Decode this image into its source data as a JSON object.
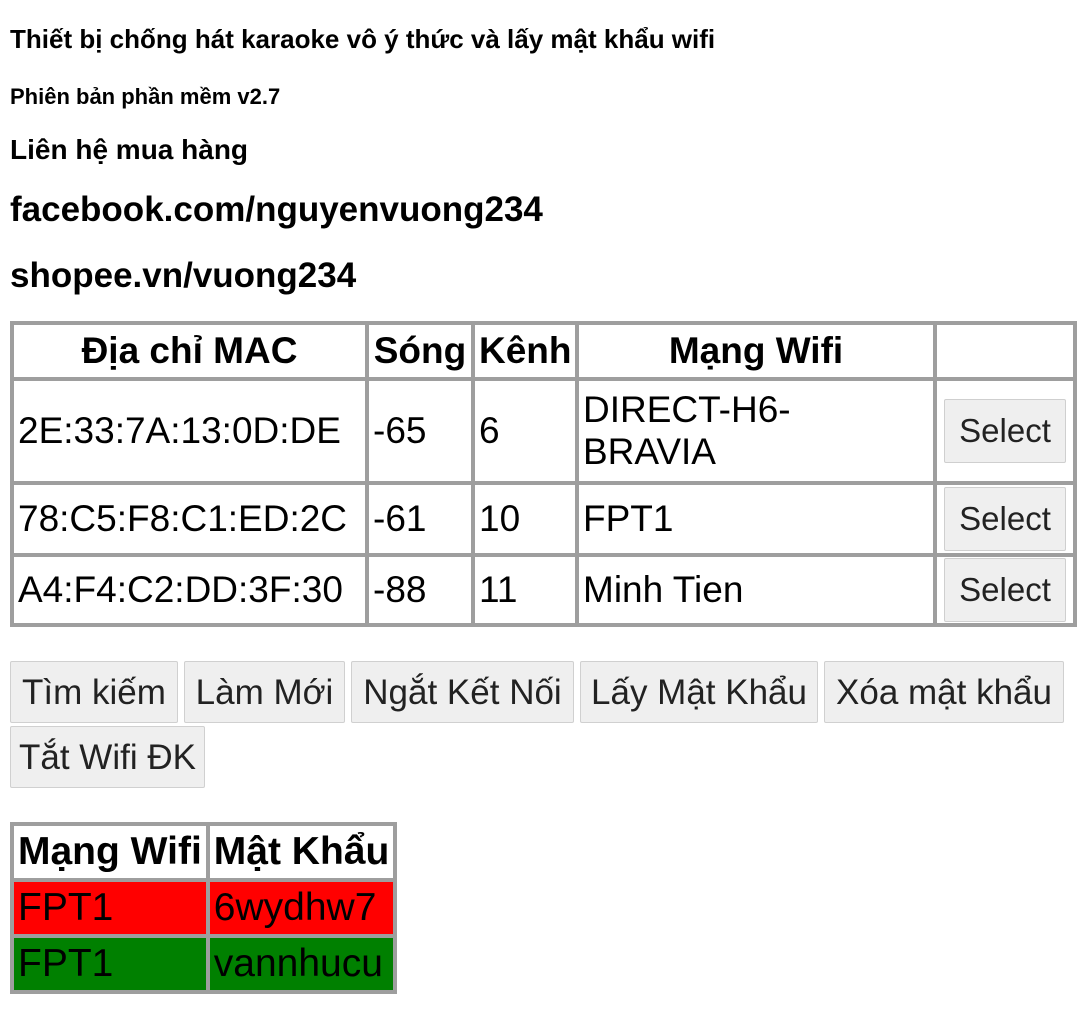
{
  "header": {
    "title": "Thiết bị chống hát karaoke vô ý thức và lấy mật khẩu wifi",
    "version": "Phiên bản phần mềm v2.7",
    "contact_label": "Liên hệ mua hàng",
    "facebook": "facebook.com/nguyenvuong234",
    "shopee": "shopee.vn/vuong234"
  },
  "scan_table": {
    "headers": [
      "Địa chỉ MAC",
      "Sóng",
      "Kênh",
      "Mạng Wifi",
      ""
    ],
    "rows": [
      {
        "mac": "2E:33:7A:13:0D:DE",
        "signal": "-65",
        "channel": "6",
        "ssid": "DIRECT-H6-BRAVIA",
        "action": "Select"
      },
      {
        "mac": "78:C5:F8:C1:ED:2C",
        "signal": "-61",
        "channel": "10",
        "ssid": "FPT1",
        "action": "Select"
      },
      {
        "mac": "A4:F4:C2:DD:3F:30",
        "signal": "-88",
        "channel": "11",
        "ssid": "Minh Tien",
        "action": "Select"
      }
    ]
  },
  "actions": {
    "search": "Tìm kiếm",
    "refresh": "Làm Mới",
    "disconnect": "Ngắt Kết Nối",
    "get_password": "Lấy Mật Khẩu",
    "delete_password": "Xóa mật khẩu",
    "wifi_off": "Tắt Wifi ĐK"
  },
  "password_table": {
    "headers": [
      "Mạng Wifi",
      "Mật Khẩu"
    ],
    "rows": [
      {
        "ssid": "FPT1",
        "password": "6wydhw7",
        "status_color": "#ff0000"
      },
      {
        "ssid": "FPT1",
        "password": "vannhucu",
        "status_color": "#008000"
      }
    ]
  },
  "colors": {
    "table_border": "#9e9e9e",
    "button_bg": "#efefef",
    "fail_row": "#ff0000",
    "success_row": "#008000"
  }
}
